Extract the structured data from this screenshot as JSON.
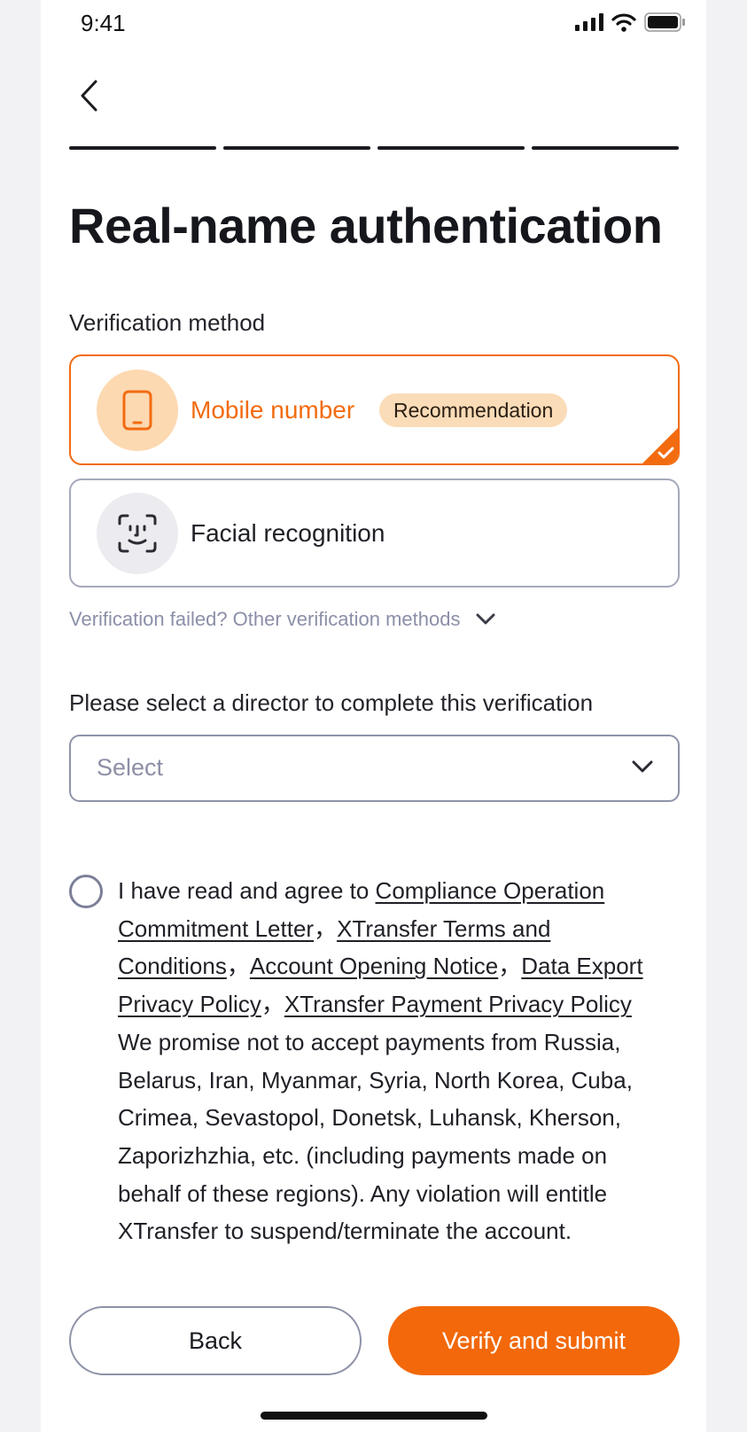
{
  "status_bar": {
    "time": "9:41"
  },
  "page": {
    "title": "Real-name authentication",
    "step_count": 4,
    "steps_completed": 4
  },
  "verification": {
    "label": "Verification method",
    "options": [
      {
        "label": "Mobile number",
        "badge": "Recommendation",
        "icon": "phone-icon",
        "selected": true
      },
      {
        "label": "Facial recognition",
        "icon": "face-scan-icon",
        "selected": false
      }
    ],
    "other_methods_link": "Verification failed? Other verification methods"
  },
  "director": {
    "label": "Please select a director to complete this verification",
    "placeholder": "Select"
  },
  "agreement": {
    "checked": false,
    "intro": "I have read and agree to ",
    "links": [
      "Compliance Operation Commitment Letter",
      "XTransfer Terms and Conditions",
      "Account Opening Notice",
      "Data Export Privacy Policy",
      "XTransfer Payment Privacy Policy"
    ],
    "separator": "，",
    "statement": "We promise not to accept payments from Russia, Belarus, Iran, Myanmar, Syria, North Korea, Cuba, Crimea, Sevastopol, Donetsk, Luhansk, Kherson, Zaporizhzhia, etc. (including payments made on behalf of these regions). Any violation will entitle XTransfer to suspend/terminate the account."
  },
  "buttons": {
    "back": "Back",
    "submit": "Verify and submit"
  },
  "colors": {
    "accent": "#f2680a",
    "badge_bg": "#fbdcb8",
    "muted": "#8b8fa8",
    "text": "#1b1c21"
  }
}
